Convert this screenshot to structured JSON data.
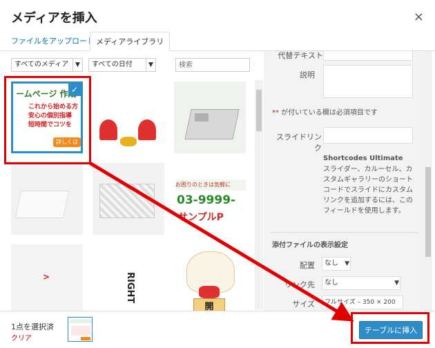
{
  "dialog": {
    "title": "メディアを挿入",
    "close": "×"
  },
  "tabs": {
    "upload": "ファイルをアップロード",
    "library": "メディアライブラリ"
  },
  "filters": {
    "media_type": "すべてのメディア",
    "date": "すべての日付",
    "search_placeholder": "検索"
  },
  "thumbs": {
    "t1_heading": "ームページ 作成",
    "t1_lines": [
      "これから始める方",
      "安心の個別指導",
      "短時間でコツを"
    ],
    "t1_button": "詳しくは",
    "t8_line1": "お困りのときは気軽に",
    "t8_phone": "03-9999-",
    "t8_sample": "サンプルP",
    "t10_arrow": ">",
    "t11_text": "RIGHT",
    "t12_sign": "開"
  },
  "sidebar": {
    "alt_label": "代替テキスト",
    "desc_label": "説明",
    "required_note": "* が付いている欄は必須項目です",
    "slide_label": "スライドリンク",
    "plugin_name": "Shortcodes Ultimate",
    "plugin_desc": "スライダー、カルーセル、カスタムギャラリーのショートコードでスライドにカスタムリンクを追加するには、このフィールドを使用します。",
    "display_settings": "添付ファイルの表示設定",
    "align_label": "配置",
    "align_value": "なし",
    "link_label": "リンク先",
    "link_value": "なし",
    "size_label": "サイズ",
    "size_value": "フルサイズ – 350 × 200"
  },
  "footer": {
    "selected": "1点を選択済",
    "clear": "クリア",
    "insert": "テーブルに挿入"
  },
  "colors": {
    "accent": "#2e8cc8",
    "highlight_red": "#e10000",
    "link": "#0073aa"
  }
}
